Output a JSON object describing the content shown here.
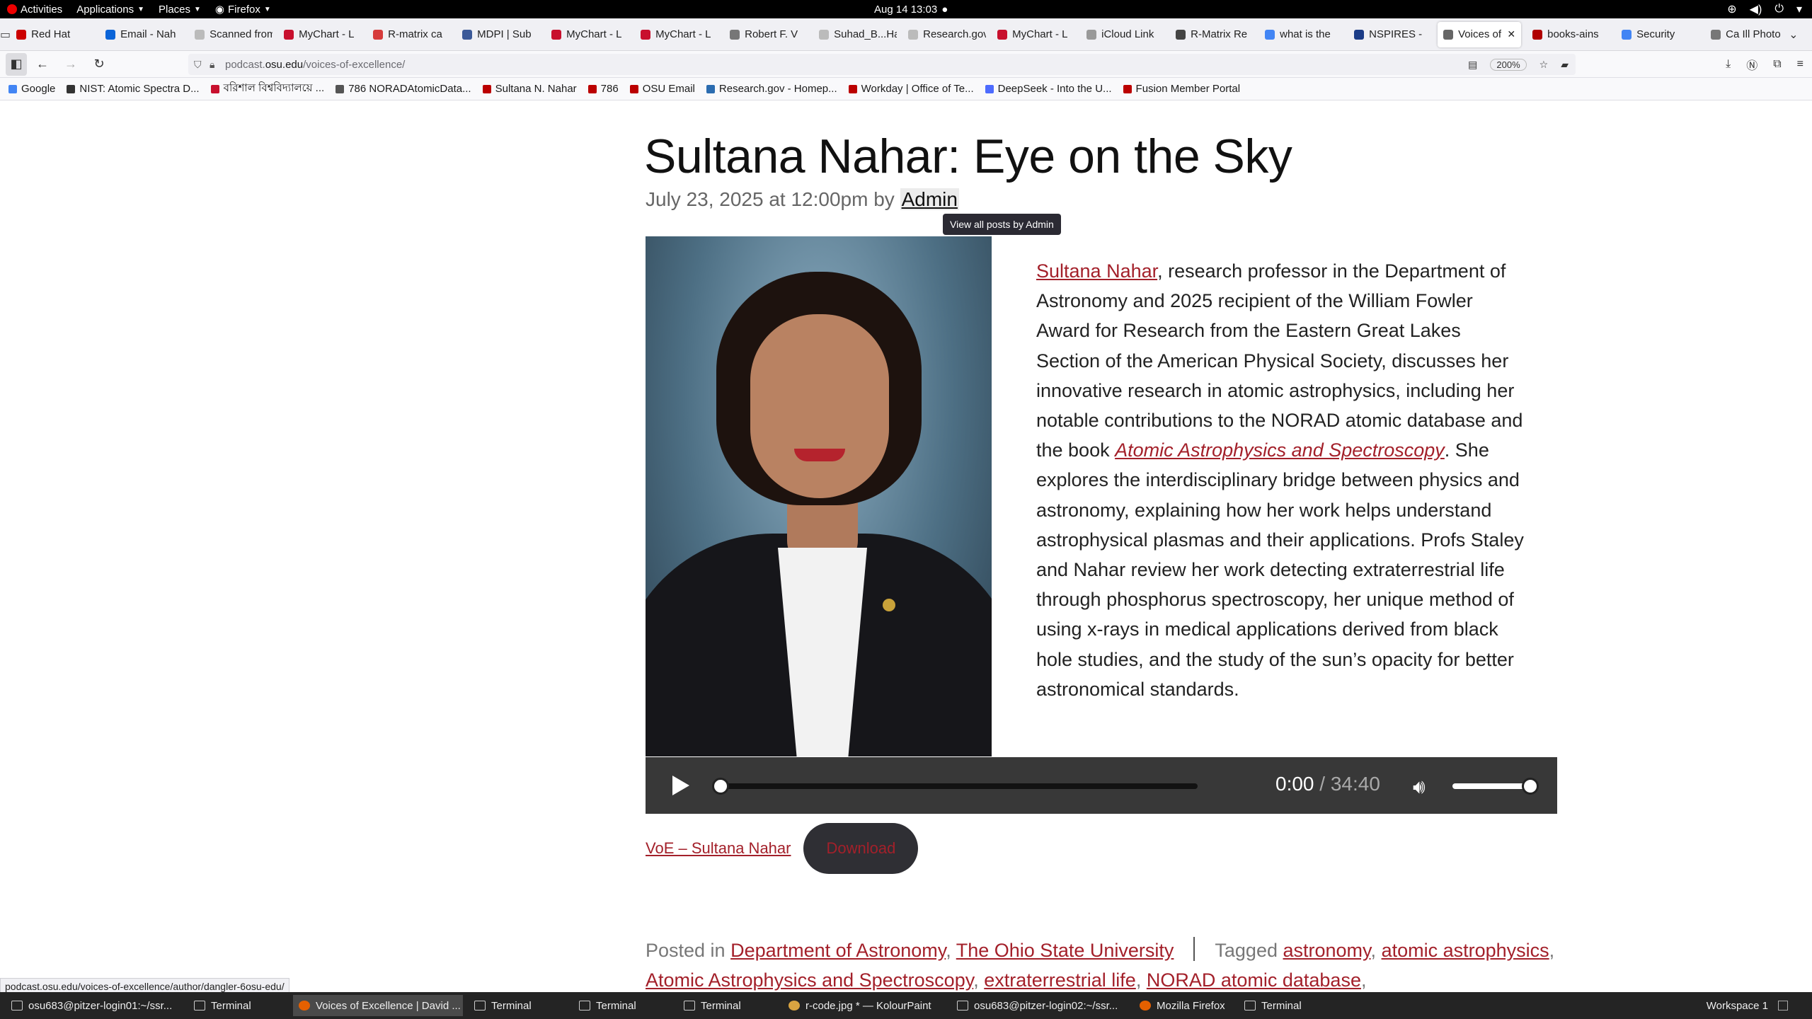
{
  "topbar": {
    "activities": "Activities",
    "applications": "Applications",
    "places": "Places",
    "firefox": "Firefox",
    "clock": "Aug 14  13:03"
  },
  "tabs": [
    {
      "label": "Red Hat",
      "color": "#cc0000"
    },
    {
      "label": "Email - Nah",
      "color": "#0a64d8"
    },
    {
      "label": "Scanned from",
      "color": "#bbbbbb"
    },
    {
      "label": "MyChart - L",
      "color": "#c8102e"
    },
    {
      "label": "R-matrix ca",
      "color": "#d63b3b"
    },
    {
      "label": "MDPI | Sub",
      "color": "#3b5998"
    },
    {
      "label": "MyChart - L",
      "color": "#c8102e"
    },
    {
      "label": "MyChart - L",
      "color": "#c8102e"
    },
    {
      "label": "Robert F. V",
      "color": "#777777"
    },
    {
      "label": "Suhad_B...Han",
      "color": "#bbbbbb"
    },
    {
      "label": "Research.gov",
      "color": "#bbbbbb"
    },
    {
      "label": "MyChart - L",
      "color": "#c8102e"
    },
    {
      "label": "iCloud Link",
      "color": "#999999"
    },
    {
      "label": "R-Matrix Re",
      "color": "#444444"
    },
    {
      "label": "what is the",
      "color": "#4285f4"
    },
    {
      "label": "NSPIRES -",
      "color": "#1b3c87"
    },
    {
      "label": "Voices of",
      "color": "#666666",
      "active": true
    },
    {
      "label": "books-ains",
      "color": "#b00000"
    },
    {
      "label": "Security",
      "color": "#4285f4"
    },
    {
      "label": "Ca Ill Photo",
      "color": "#777777"
    }
  ],
  "url": {
    "host": "podcast.osu.edu",
    "prefix": "podcast.",
    "domain": "osu.edu",
    "path": "/voices-of-excellence/",
    "zoom": "200%"
  },
  "bookmarks": [
    {
      "label": "Google",
      "color": "#4285f4"
    },
    {
      "label": "NIST: Atomic Spectra D...",
      "color": "#333333"
    },
    {
      "label": "বরিশাল বিশ্ববিদ্যালয়ে ...",
      "color": "#c8102e"
    },
    {
      "label": "786 NORADAtomicData...",
      "color": "#555555"
    },
    {
      "label": "Sultana N. Nahar",
      "color": "#bb0000"
    },
    {
      "label": "786",
      "color": "#bb0000"
    },
    {
      "label": "OSU Email",
      "color": "#bb0000"
    },
    {
      "label": "Research.gov - Homep...",
      "color": "#2b6cb0"
    },
    {
      "label": "Workday | Office of Te...",
      "color": "#bb0000"
    },
    {
      "label": "DeepSeek - Into the U...",
      "color": "#4d6bfe"
    },
    {
      "label": "Fusion Member Portal",
      "color": "#bb0000"
    }
  ],
  "post": {
    "title": "Sultana Nahar: Eye on the Sky",
    "date": "July 23, 2025 at 12:00pm by ",
    "author": "Admin",
    "tooltip": "View all posts by Admin",
    "desc_link": "Sultana Nahar",
    "desc_part1": ", research professor in the Department of Astronomy and 2025 recipient of the William Fowler Award for Research from the Eastern Great Lakes Section of the American Physical Society, discusses her innovative research in atomic astrophysics, including her notable contributions to the NORAD atomic database and the book ",
    "desc_book": "Atomic Astrophysics and Spectroscopy",
    "desc_part2": ". She explores the interdisciplinary bridge between physics and astronomy, explaining how her work helps understand astrophysical plasmas and their applications. Profs Staley and Nahar review her work detecting extraterrestrial life through phosphorus spectroscopy, her unique method of using x-rays in medical applications derived from black hole studies, and the study of the sun’s opacity for better astronomical standards."
  },
  "player": {
    "current": "0:00",
    "separator": " / ",
    "duration": "34:40",
    "progress": 0,
    "volume": 1.0
  },
  "download": {
    "link": "VoE – Sultana Nahar",
    "button": "Download"
  },
  "taxonomy": {
    "posted_in_label": "Posted in",
    "categories": [
      "Department of Astronomy",
      "The Ohio State University"
    ],
    "tagged_label": "Tagged",
    "tags": [
      "astronomy",
      "atomic astrophysics",
      "Atomic Astrophysics and Spectroscopy",
      "extraterrestrial life",
      "NORAD atomic database"
    ]
  },
  "status_url": "podcast.osu.edu/voices-of-excellence/author/dangler-6osu-edu/",
  "taskbar": [
    {
      "label": "osu683@pitzer-login01:~/ssr...",
      "icon": "terminal"
    },
    {
      "label": "Terminal",
      "icon": "terminal"
    },
    {
      "label": "Voices of Excellence | David ...",
      "icon": "firefox",
      "active": true
    },
    {
      "label": "Terminal",
      "icon": "terminal"
    },
    {
      "label": "Terminal",
      "icon": "terminal"
    },
    {
      "label": "Terminal",
      "icon": "terminal"
    },
    {
      "label": "r-code.jpg * — KolourPaint",
      "icon": "paint"
    },
    {
      "label": "osu683@pitzer-login02:~/ssr...",
      "icon": "terminal"
    },
    {
      "label": "Mozilla Firefox",
      "icon": "firefox"
    },
    {
      "label": "Terminal",
      "icon": "terminal"
    }
  ],
  "workspace": "Workspace 1"
}
